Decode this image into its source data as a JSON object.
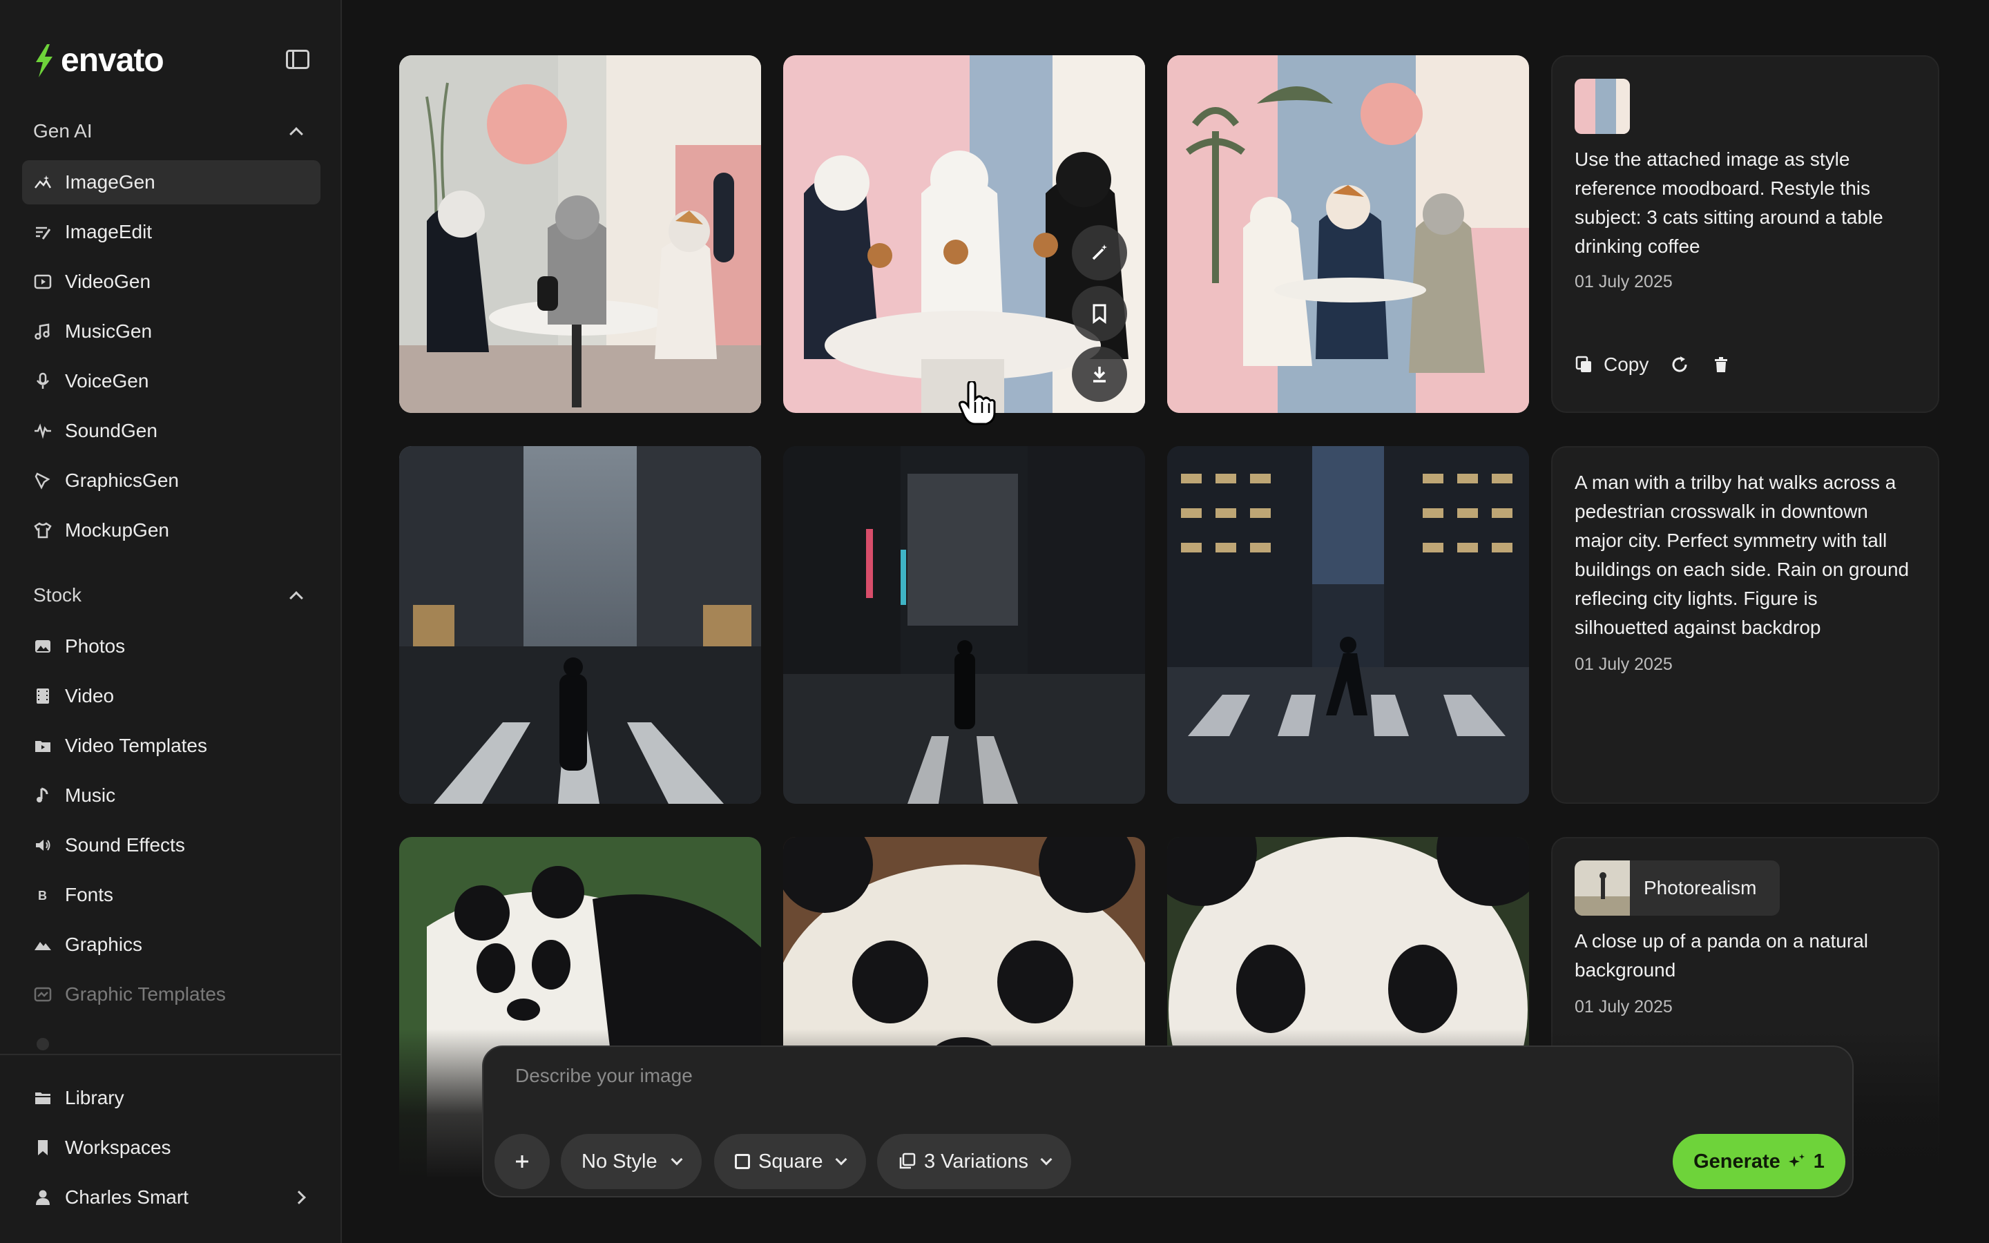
{
  "brand": {
    "name": "envato",
    "accent": "#6ed33a"
  },
  "sidebar": {
    "genai_title": "Gen AI",
    "genai_items": [
      {
        "label": "ImageGen",
        "icon": "image-gen-icon"
      },
      {
        "label": "ImageEdit",
        "icon": "image-edit-icon"
      },
      {
        "label": "VideoGen",
        "icon": "video-gen-icon"
      },
      {
        "label": "MusicGen",
        "icon": "music-note-icon"
      },
      {
        "label": "VoiceGen",
        "icon": "microphone-icon"
      },
      {
        "label": "SoundGen",
        "icon": "waveform-icon"
      },
      {
        "label": "GraphicsGen",
        "icon": "pen-nib-icon"
      },
      {
        "label": "MockupGen",
        "icon": "tshirt-icon"
      }
    ],
    "stock_title": "Stock",
    "stock_items": [
      {
        "label": "Photos",
        "icon": "photo-icon"
      },
      {
        "label": "Video",
        "icon": "film-icon"
      },
      {
        "label": "Video Templates",
        "icon": "video-template-icon"
      },
      {
        "label": "Music",
        "icon": "music-icon"
      },
      {
        "label": "Sound Effects",
        "icon": "speaker-icon"
      },
      {
        "label": "Fonts",
        "icon": "font-icon"
      },
      {
        "label": "Graphics",
        "icon": "mountain-icon"
      },
      {
        "label": "Graphic Templates",
        "icon": "template-icon"
      }
    ],
    "bottom_items": [
      {
        "label": "Library",
        "icon": "folder-icon"
      },
      {
        "label": "Workspaces",
        "icon": "bookmark-icon"
      },
      {
        "label": "Charles Smart",
        "icon": "user-icon"
      }
    ]
  },
  "generations": [
    {
      "prompt": "Use the attached image as style reference moodboard. Restyle this subject: 3 cats sitting around a table drinking coffee",
      "date": "01 July 2025",
      "actions": {
        "copy": "Copy"
      }
    },
    {
      "prompt": "A man with a trilby hat walks across a pedestrian crosswalk in downtown major city. Perfect symmetry with tall buildings on each side. Rain on ground reflecing city lights. Figure is silhouetted against backdrop",
      "date": "01 July 2025"
    },
    {
      "style": "Photorealism",
      "prompt": "A close up of a panda on a natural background",
      "date": "01 July 2025"
    }
  ],
  "prompt_bar": {
    "placeholder": "Describe your image",
    "style": "No Style",
    "aspect": "Square",
    "variations": "3 Variations",
    "generate": "Generate",
    "credits": "1"
  }
}
